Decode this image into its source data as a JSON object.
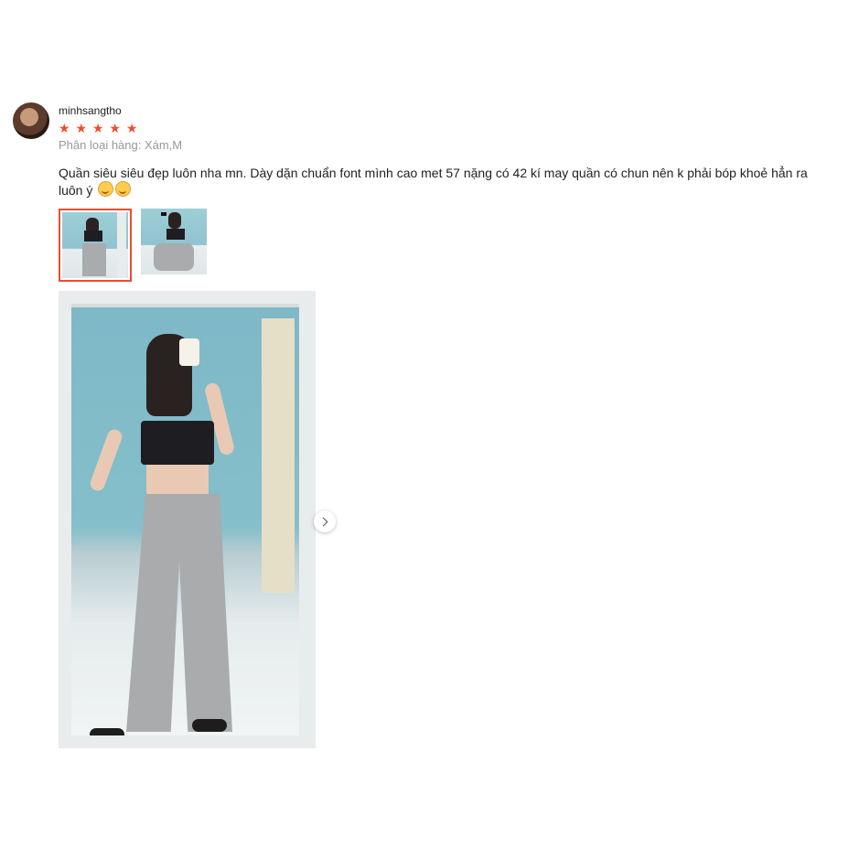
{
  "review": {
    "username": "minhsangtho",
    "rating_stars": [
      "★",
      "★",
      "★",
      "★",
      "★"
    ],
    "rating": 5,
    "variant_label": "Phân loại hàng: Xám,M",
    "comment": "Quần siêu siêu đẹp luôn nha mn. Dày dặn chuẩn font mình cao met 57 nặng có 42 kí may quần có chun nên k phải bóp khoẻ hẳn ra luôn ý",
    "emojis": [
      "smiling-face-with-hearts-emoji",
      "smiling-face-with-hearts-emoji"
    ],
    "thumbnails_selected_index": 0,
    "next_icon": "chevron-right-icon"
  },
  "colors": {
    "accent": "#ee4d2d",
    "muted_text": "#999999"
  }
}
